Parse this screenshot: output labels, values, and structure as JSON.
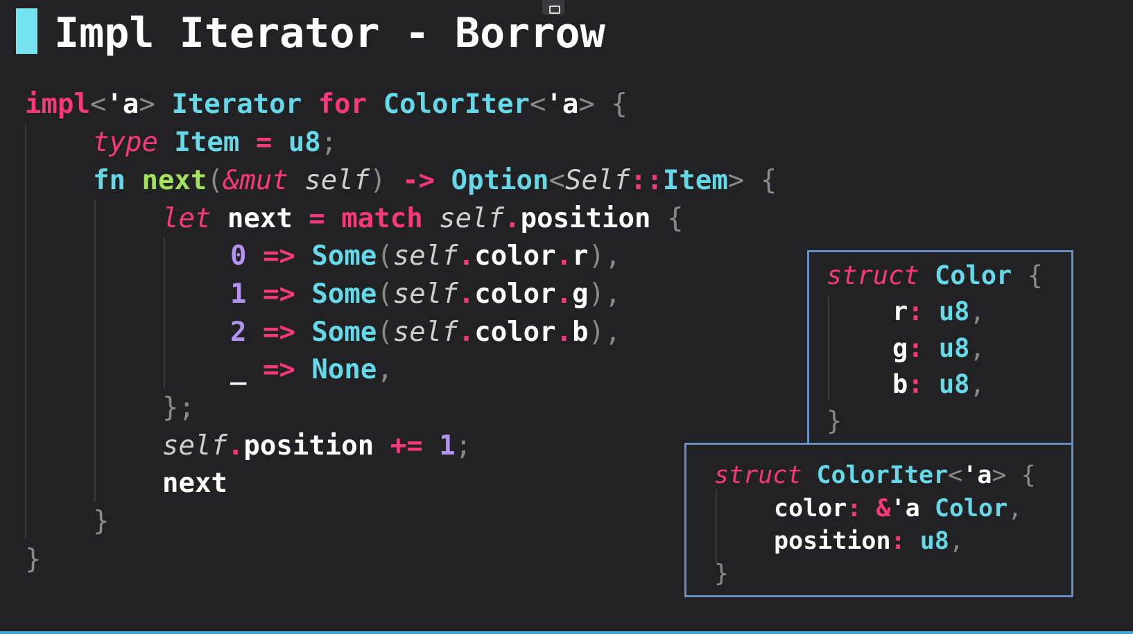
{
  "title": "Impl Iterator - Borrow",
  "main_code": [
    [
      [
        "k",
        "impl"
      ],
      [
        "p",
        "<"
      ],
      [
        "w",
        "'a"
      ],
      [
        "p",
        ">"
      ],
      [
        "w",
        " "
      ],
      [
        "t",
        "Iterator"
      ],
      [
        "w",
        " "
      ],
      [
        "k",
        "for"
      ],
      [
        "w",
        " "
      ],
      [
        "t",
        "ColorIter"
      ],
      [
        "p",
        "<"
      ],
      [
        "w",
        "'a"
      ],
      [
        "p",
        ">"
      ],
      [
        "w",
        " "
      ],
      [
        "p",
        "{"
      ]
    ],
    [
      [
        "ki",
        "type"
      ],
      [
        "w",
        " "
      ],
      [
        "t",
        "Item"
      ],
      [
        "w",
        " "
      ],
      [
        "k",
        "="
      ],
      [
        "w",
        " "
      ],
      [
        "t",
        "u8"
      ],
      [
        "p",
        ";"
      ]
    ],
    [
      [
        "t",
        "fn"
      ],
      [
        "w",
        " "
      ],
      [
        "g",
        "next"
      ],
      [
        "p",
        "("
      ],
      [
        "ki",
        "&mut"
      ],
      [
        "w",
        " "
      ],
      [
        "si",
        "self"
      ],
      [
        "p",
        ")"
      ],
      [
        "w",
        " "
      ],
      [
        "k",
        "->"
      ],
      [
        "w",
        " "
      ],
      [
        "t",
        "Option"
      ],
      [
        "p",
        "<"
      ],
      [
        "si",
        "Self"
      ],
      [
        "k",
        "::"
      ],
      [
        "t",
        "Item"
      ],
      [
        "p",
        ">"
      ],
      [
        "w",
        " "
      ],
      [
        "p",
        "{"
      ]
    ],
    [
      [
        "ki",
        "let"
      ],
      [
        "w",
        " next "
      ],
      [
        "k",
        "="
      ],
      [
        "w",
        " "
      ],
      [
        "k",
        "match"
      ],
      [
        "w",
        " "
      ],
      [
        "si",
        "self"
      ],
      [
        "k",
        "."
      ],
      [
        "w",
        "position "
      ],
      [
        "p",
        "{"
      ]
    ],
    [
      [
        "n",
        "0"
      ],
      [
        "w",
        " "
      ],
      [
        "k",
        "=>"
      ],
      [
        "w",
        " "
      ],
      [
        "t",
        "Some"
      ],
      [
        "p",
        "("
      ],
      [
        "si",
        "self"
      ],
      [
        "k",
        "."
      ],
      [
        "w",
        "color"
      ],
      [
        "k",
        "."
      ],
      [
        "w",
        "r"
      ],
      [
        "p",
        "),"
      ]
    ],
    [
      [
        "n",
        "1"
      ],
      [
        "w",
        " "
      ],
      [
        "k",
        "=>"
      ],
      [
        "w",
        " "
      ],
      [
        "t",
        "Some"
      ],
      [
        "p",
        "("
      ],
      [
        "si",
        "self"
      ],
      [
        "k",
        "."
      ],
      [
        "w",
        "color"
      ],
      [
        "k",
        "."
      ],
      [
        "w",
        "g"
      ],
      [
        "p",
        "),"
      ]
    ],
    [
      [
        "n",
        "2"
      ],
      [
        "w",
        " "
      ],
      [
        "k",
        "=>"
      ],
      [
        "w",
        " "
      ],
      [
        "t",
        "Some"
      ],
      [
        "p",
        "("
      ],
      [
        "si",
        "self"
      ],
      [
        "k",
        "."
      ],
      [
        "w",
        "color"
      ],
      [
        "k",
        "."
      ],
      [
        "w",
        "b"
      ],
      [
        "p",
        "),"
      ]
    ],
    [
      [
        "w",
        "_"
      ],
      [
        "w",
        " "
      ],
      [
        "k",
        "=>"
      ],
      [
        "w",
        " "
      ],
      [
        "t",
        "None"
      ],
      [
        "p",
        ","
      ]
    ],
    [
      [
        "p",
        "};"
      ]
    ],
    [
      [
        "si",
        "self"
      ],
      [
        "k",
        "."
      ],
      [
        "w",
        "position "
      ],
      [
        "k",
        "+="
      ],
      [
        "w",
        " "
      ],
      [
        "n",
        "1"
      ],
      [
        "p",
        ";"
      ]
    ],
    [
      [
        "w",
        "next"
      ]
    ],
    [
      [
        "p",
        "}"
      ]
    ],
    [
      [
        "p",
        "}"
      ]
    ]
  ],
  "color_struct": [
    [
      [
        "ki",
        "struct"
      ],
      [
        "w",
        " "
      ],
      [
        "t",
        "Color"
      ],
      [
        "w",
        " "
      ],
      [
        "p",
        "{"
      ]
    ],
    [
      [
        "w",
        "r"
      ],
      [
        "k",
        ":"
      ],
      [
        "w",
        " "
      ],
      [
        "t",
        "u8"
      ],
      [
        "p",
        ","
      ]
    ],
    [
      [
        "w",
        "g"
      ],
      [
        "k",
        ":"
      ],
      [
        "w",
        " "
      ],
      [
        "t",
        "u8"
      ],
      [
        "p",
        ","
      ]
    ],
    [
      [
        "w",
        "b"
      ],
      [
        "k",
        ":"
      ],
      [
        "w",
        " "
      ],
      [
        "t",
        "u8"
      ],
      [
        "p",
        ","
      ]
    ],
    [
      [
        "p",
        "}"
      ]
    ]
  ],
  "coloriter_struct": [
    [
      [
        "ki",
        "struct"
      ],
      [
        "w",
        " "
      ],
      [
        "t",
        "ColorIter"
      ],
      [
        "p",
        "<"
      ],
      [
        "w",
        "'a"
      ],
      [
        "p",
        ">"
      ],
      [
        "w",
        " "
      ],
      [
        "p",
        "{"
      ]
    ],
    [
      [
        "w",
        "color"
      ],
      [
        "k",
        ":"
      ],
      [
        "w",
        " "
      ],
      [
        "k",
        "&"
      ],
      [
        "w",
        "'a"
      ],
      [
        "w",
        " "
      ],
      [
        "t",
        "Color"
      ],
      [
        "p",
        ","
      ]
    ],
    [
      [
        "w",
        "position"
      ],
      [
        "k",
        ":"
      ],
      [
        "w",
        " "
      ],
      [
        "t",
        "u8"
      ],
      [
        "p",
        ","
      ]
    ],
    [
      [
        "p",
        "}"
      ]
    ]
  ]
}
